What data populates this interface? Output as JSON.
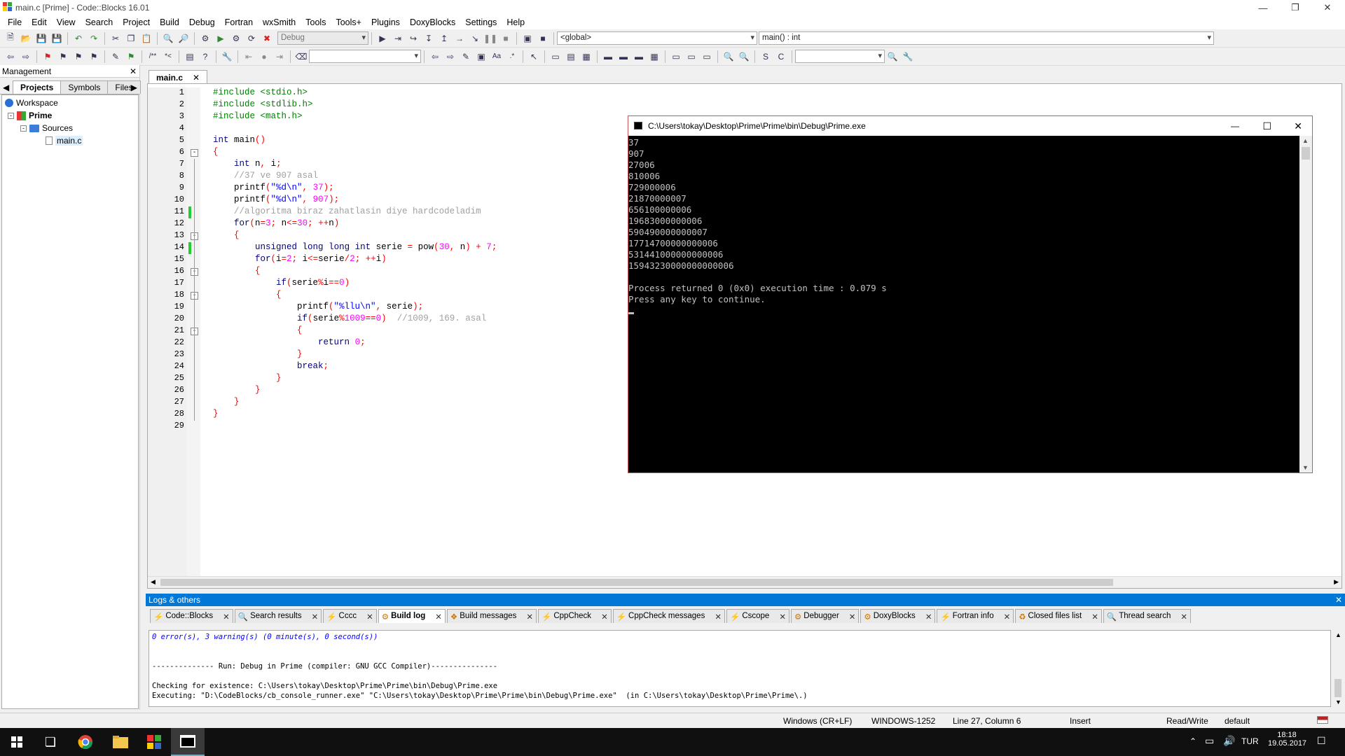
{
  "window": {
    "title": "main.c [Prime] - Code::Blocks 16.01"
  },
  "menu": [
    "File",
    "Edit",
    "View",
    "Search",
    "Project",
    "Build",
    "Debug",
    "Fortran",
    "wxSmith",
    "Tools",
    "Tools+",
    "Plugins",
    "DoxyBlocks",
    "Settings",
    "Help"
  ],
  "toolbar": {
    "build_target": "Debug",
    "scope": "<global>",
    "function": "main() : int"
  },
  "management": {
    "title": "Management",
    "tabs": [
      "Projects",
      "Symbols",
      "Files"
    ],
    "tree": {
      "workspace": "Workspace",
      "project": "Prime",
      "folder": "Sources",
      "file": "main.c"
    }
  },
  "editor": {
    "tab": "main.c",
    "line_numbers": [
      "1",
      "2",
      "3",
      "4",
      "5",
      "6",
      "7",
      "8",
      "9",
      "10",
      "11",
      "12",
      "13",
      "14",
      "15",
      "16",
      "17",
      "18",
      "19",
      "20",
      "21",
      "22",
      "23",
      "24",
      "25",
      "26",
      "27",
      "28",
      "29"
    ],
    "code": [
      "#include <stdio.h>",
      "#include <stdlib.h>",
      "#include <math.h>",
      "",
      "int main()",
      "{",
      "    int n, i;",
      "    //37 ve 907 asal",
      "    printf(\"%d\\n\", 37);",
      "    printf(\"%d\\n\", 907);",
      "    //algoritma biraz zahatlasin diye hardcodeladim",
      "    for(n=3; n<=30; ++n)",
      "    {",
      "        unsigned long long int serie = pow(30, n) + 7;",
      "        for(i=2; i<=serie/2; ++i)",
      "        {",
      "            if(serie%i==0)",
      "            {",
      "                printf(\"%llu\\n\", serie);",
      "                if(serie%1009==0)  //1009, 169. asal",
      "                {",
      "                    return 0;",
      "                }",
      "                break;",
      "            }",
      "        }",
      "    }",
      "}",
      ""
    ]
  },
  "console": {
    "title": "C:\\Users\\tokay\\Desktop\\Prime\\Prime\\bin\\Debug\\Prime.exe",
    "lines": [
      "37",
      "907",
      "27006",
      "810006",
      "729000006",
      "21870000007",
      "656100000006",
      "19683000000006",
      "590490000000007",
      "17714700000000006",
      "531441000000000006",
      "15943230000000000006",
      "",
      "Process returned 0 (0x0)   execution time : 0.079 s",
      "Press any key to continue."
    ]
  },
  "logs": {
    "title": "Logs & others",
    "tabs": [
      "Code::Blocks",
      "Search results",
      "Cccc",
      "Build log",
      "Build messages",
      "CppCheck",
      "CppCheck messages",
      "Cscope",
      "Debugger",
      "DoxyBlocks",
      "Fortran info",
      "Closed files list",
      "Thread search"
    ],
    "active_tab": "Build log",
    "lines": [
      "0 error(s), 3 warning(s) (0 minute(s), 0 second(s))",
      "",
      "",
      "-------------- Run: Debug in Prime (compiler: GNU GCC Compiler)---------------",
      "",
      "Checking for existence: C:\\Users\\tokay\\Desktop\\Prime\\Prime\\bin\\Debug\\Prime.exe",
      "Executing: \"D:\\CodeBlocks/cb_console_runner.exe\" \"C:\\Users\\tokay\\Desktop\\Prime\\Prime\\bin\\Debug\\Prime.exe\"  (in C:\\Users\\tokay\\Desktop\\Prime\\Prime\\.)"
    ]
  },
  "status": {
    "eol": "Windows (CR+LF)",
    "encoding": "WINDOWS-1252",
    "position": "Line 27, Column 6",
    "mode": "Insert",
    "access": "Read/Write",
    "profile": "default"
  },
  "taskbar": {
    "language": "TUR",
    "time": "18:18",
    "date": "19.05.2017"
  }
}
